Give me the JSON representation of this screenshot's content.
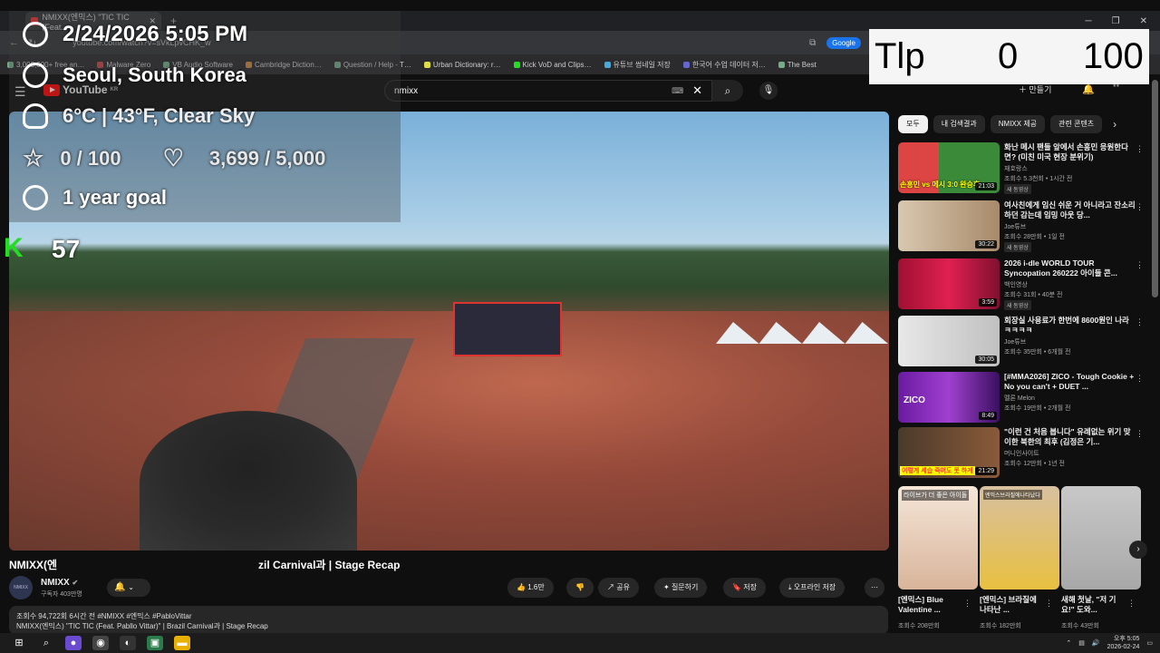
{
  "browser": {
    "tab_title": "NMIXX(엔믹스) \"TIC TIC (Feat.",
    "address_url": "youtube.com/watch?v=sVkLpvCHK_w",
    "google_button": "Google",
    "bookmarks": [
      "3,000,000+ free an…",
      "Malware Zero",
      "VB Audio Software",
      "Cambridge Diction…",
      "Question / Help - T…",
      "Urban Dictionary: r…",
      "Kick VoD and Clips…",
      "유튜브 썸네일 저장",
      "한국어 수업 데이터 저…",
      "The Best"
    ]
  },
  "youtube": {
    "logo_text": "YouTube",
    "logo_region": "KR",
    "search_value": "nmixx",
    "create_label": "만들기"
  },
  "video": {
    "title_left": "NMIXX(엔",
    "title_right": "zil Carnival과 | Stage Recap",
    "channel_name": "NMIXX",
    "channel_avatar_text": "NMIXX",
    "subscribers": "구독자 403만명",
    "likes": "1.6만",
    "share": "공유",
    "ask": "질문하기",
    "save": "저장",
    "download": "오프라인 저장",
    "desc_line1": "조회수 94,722회  6시간 전  #NMIXX #엔믹스 #PabloVittar",
    "desc_line2": "NMIXX(엔믹스) \"TIC TIC (Feat. Pabllo Vittar)\" | Brazil Carnival과 | Stage Recap"
  },
  "chips": [
    "모두",
    "내 검색결과",
    "NMIXX 제공",
    "관련 콘텐츠"
  ],
  "recommendations": [
    {
      "title": "화난 메시 팬들 앞에서 손흥민 응원한다면? (미친 미국 현장 분위기)",
      "channel": "재호랑스",
      "meta": "조회수 5.3천회 • 1시간 전",
      "badge": "새 동영상",
      "duration": "21:03",
      "thumb_text": "손흥민 vs 메시 3:0 완승후"
    },
    {
      "title": "여사친에게 임신 쉬운 거 아니라고 잔소리하던 감는데 임밍 아웃 당...",
      "channel": "Joe튜브",
      "meta": "조회수 28만회 • 1일 전",
      "badge": "새 동영상",
      "duration": "30:22",
      "thumb_text": ""
    },
    {
      "title": "2026 i-dle WORLD TOUR Syncopation 260222 아이들 콘...",
      "channel": "백인영상",
      "meta": "조회수 31회 • 40분 전",
      "badge": "새 동영상",
      "duration": "3:59",
      "thumb_text": ""
    },
    {
      "title": "회장실 사용료가 한번에 8600원인 나라ㅋㅋㅋㅋ",
      "channel": "Joe튜브",
      "meta": "조회수 35만회 • 6개월 전",
      "badge": "",
      "duration": "30:05",
      "thumb_text": ""
    },
    {
      "title": "[#MMA2026] ZICO - Tough Cookie + No you can't + DUET ...",
      "channel": "멜론 Melon",
      "meta": "조회수 19만회 • 2개월 전",
      "badge": "",
      "duration": "8:49",
      "thumb_text": "ZICO"
    },
    {
      "title": "\"이런 건 처음 봅니다\" 유례없는 위기 맞이한 북한의 최후 (김정은 기...",
      "channel": "머니인사이트",
      "meta": "조회수 12만회 • 1년 전",
      "badge": "",
      "duration": "21:29",
      "thumb_text": "이렇게 세습 죽어도 못 하게"
    }
  ],
  "shorts": [
    {
      "title": "[엔믹스] Blue Valentine ...",
      "views": "조회수 208만회",
      "thumb_text": "라이브가 더 좋은 아이돌"
    },
    {
      "title": "[엔믹스] 브라질에 나타난 ...",
      "views": "조회수 182만회",
      "thumb_text": "엔믹스브라질에나타났다"
    },
    {
      "title": "새해 첫날, \"저 기요!\" 도와...",
      "views": "조회수 43만회",
      "thumb_text": ""
    }
  ],
  "overlay": {
    "datetime": "2/24/2026 5:05 PM",
    "location": "Seoul, South Korea",
    "weather": "6°C | 43°F, Clear Sky",
    "score": "0 / 100",
    "hearts": "3,699 / 5,000",
    "goal": "1 year goal",
    "tlp_label": "Tlp",
    "tlp_value": "0",
    "tlp_max": "100",
    "kick_label": "K",
    "kick_viewers": "57"
  },
  "taskbar": {
    "time": "오후 5:05",
    "date": "2026-02-24"
  },
  "colors": {
    "yt_red": "#ff0000",
    "bg": "#0f0f0f",
    "kick_green": "#22dd22",
    "chip_bg": "#272727"
  }
}
